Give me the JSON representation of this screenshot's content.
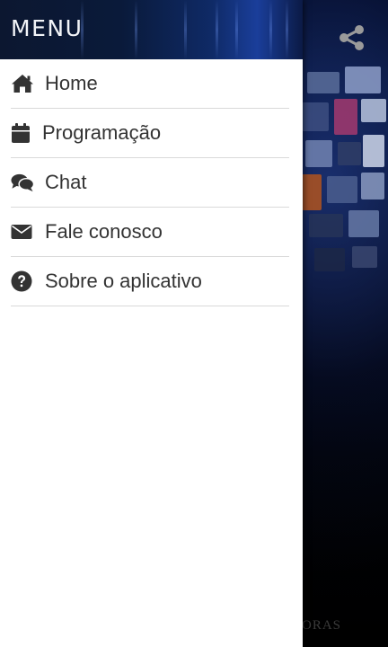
{
  "drawer": {
    "title": "MENU",
    "items": [
      {
        "label": "Home",
        "icon": "home-icon"
      },
      {
        "label": "Programação",
        "icon": "calendar-icon"
      },
      {
        "label": "Chat",
        "icon": "chat-icon"
      },
      {
        "label": "Fale conosco",
        "icon": "envelope-icon"
      },
      {
        "label": "Sobre o aplicativo",
        "icon": "question-circle-icon"
      }
    ]
  },
  "background": {
    "share_icon": "share-icon",
    "brand_fragment": "ORAS"
  },
  "colors": {
    "header": "#0f2a66",
    "drawer_bg": "#ffffff",
    "menu_text": "#333333",
    "divider": "#d9d9d9",
    "share_icon": "#9a9a9a"
  }
}
